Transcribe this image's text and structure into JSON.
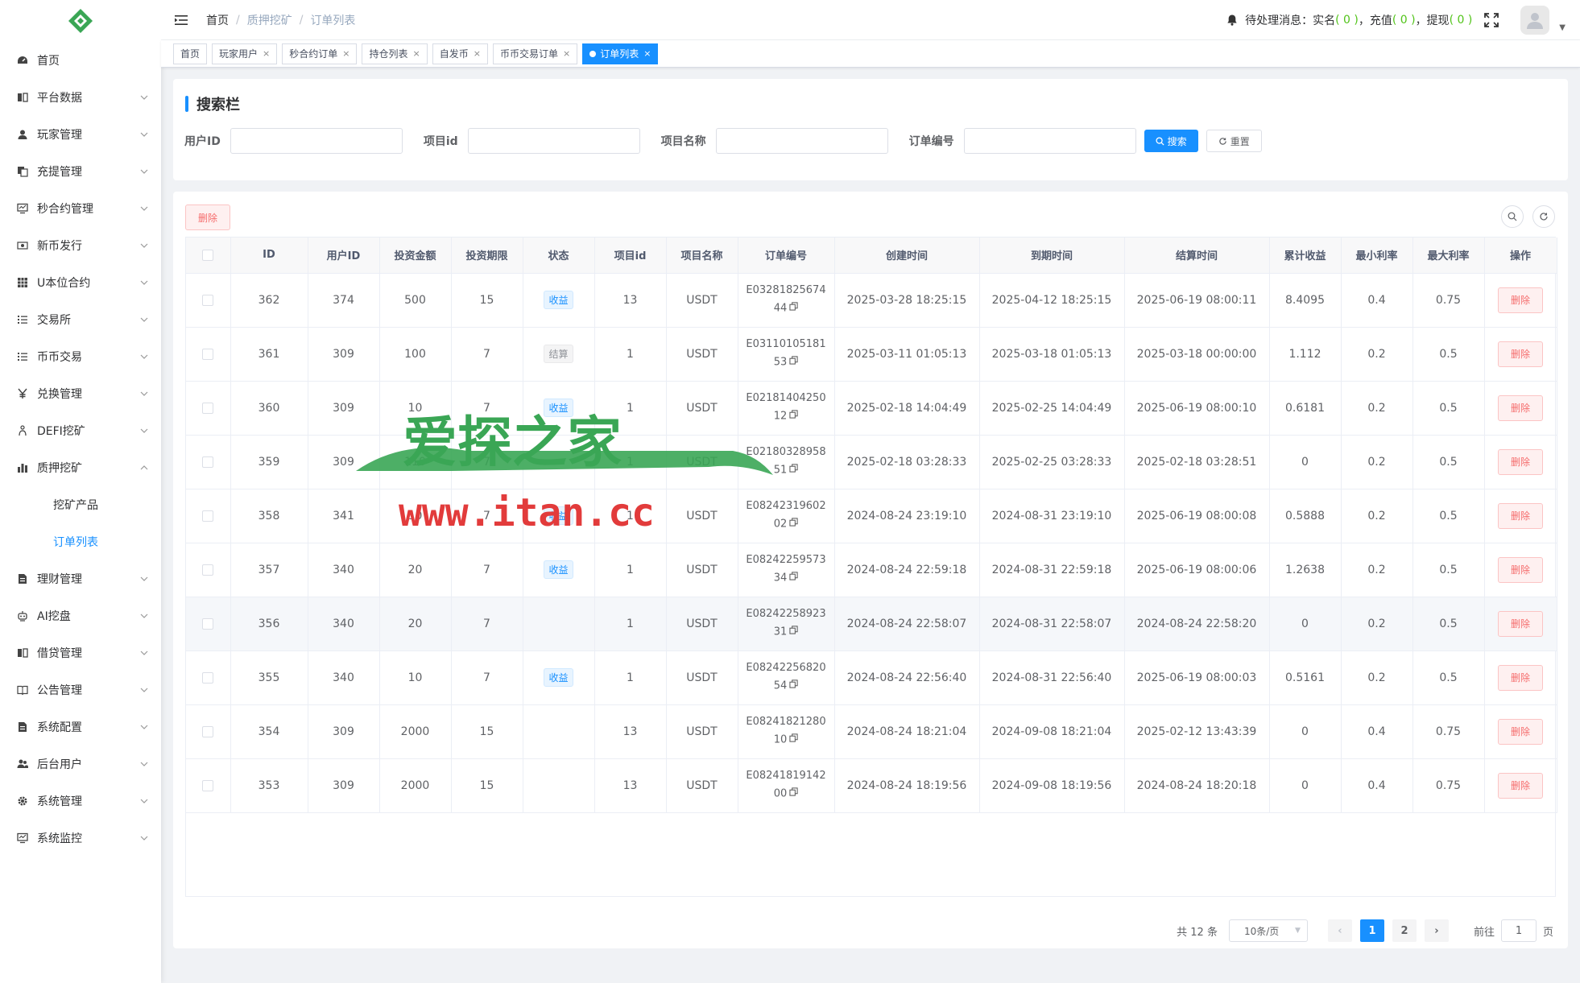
{
  "sidebar": {
    "items": [
      {
        "label": "首页",
        "icon": "dashboard-icon",
        "arrow": false
      },
      {
        "label": "平台数据",
        "icon": "book-icon",
        "arrow": true
      },
      {
        "label": "玩家管理",
        "icon": "user-icon",
        "arrow": true
      },
      {
        "label": "充提管理",
        "icon": "copy-icon",
        "arrow": true
      },
      {
        "label": "秒合约管理",
        "icon": "monitor-icon",
        "arrow": true
      },
      {
        "label": "新币发行",
        "icon": "money-icon",
        "arrow": true
      },
      {
        "label": "U本位合约",
        "icon": "grid-icon",
        "arrow": true
      },
      {
        "label": "交易所",
        "icon": "list-icon",
        "arrow": true
      },
      {
        "label": "币币交易",
        "icon": "list-icon",
        "arrow": true
      },
      {
        "label": "兑换管理",
        "icon": "yen-icon",
        "arrow": true
      },
      {
        "label": "DEFI挖矿",
        "icon": "druid-icon",
        "arrow": true
      },
      {
        "label": "质押挖矿",
        "icon": "chart-icon",
        "arrow": true,
        "expanded": true
      },
      {
        "label": "理财管理",
        "icon": "form-icon",
        "arrow": true
      },
      {
        "label": "AI挖盘",
        "icon": "robot-icon",
        "arrow": true
      },
      {
        "label": "借贷管理",
        "icon": "book-icon",
        "arrow": true
      },
      {
        "label": "公告管理",
        "icon": "read-icon",
        "arrow": true
      },
      {
        "label": "系统配置",
        "icon": "form-icon",
        "arrow": true
      },
      {
        "label": "后台用户",
        "icon": "peoples-icon",
        "arrow": true
      },
      {
        "label": "系统管理",
        "icon": "gear-icon",
        "arrow": true
      },
      {
        "label": "系统监控",
        "icon": "monitor-icon",
        "arrow": true
      }
    ],
    "submenu": [
      {
        "label": "挖矿产品",
        "active": false
      },
      {
        "label": "订单列表",
        "active": true
      }
    ]
  },
  "breadcrumb": [
    "首页",
    "质押挖矿",
    "订单列表"
  ],
  "topbar": {
    "pending_label": "待处理消息：",
    "real_name_label": "实名",
    "real_name_count": "( 0 )",
    "recharge_label": "，充值",
    "recharge_count": "( 0 )",
    "withdraw_label": "，提现",
    "withdraw_count": "( 0 )"
  },
  "tags": [
    {
      "label": "首页",
      "closable": false,
      "active": false
    },
    {
      "label": "玩家用户",
      "closable": true,
      "active": false
    },
    {
      "label": "秒合约订单",
      "closable": true,
      "active": false
    },
    {
      "label": "持仓列表",
      "closable": true,
      "active": false
    },
    {
      "label": "自发币",
      "closable": true,
      "active": false
    },
    {
      "label": "币币交易订单",
      "closable": true,
      "active": false
    },
    {
      "label": "订单列表",
      "closable": true,
      "active": true
    }
  ],
  "search": {
    "title": "搜索栏",
    "fields": [
      {
        "label": "用户ID",
        "value": ""
      },
      {
        "label": "项目id",
        "value": ""
      },
      {
        "label": "项目名称",
        "value": ""
      },
      {
        "label": "订单编号",
        "value": ""
      }
    ],
    "search_btn": "搜索",
    "reset_btn": "重置"
  },
  "toolbar": {
    "delete_label": "删除"
  },
  "table": {
    "columns": [
      "ID",
      "用户ID",
      "投资金额",
      "投资期限",
      "状态",
      "项目id",
      "项目名称",
      "订单编号",
      "创建时间",
      "到期时间",
      "结算时间",
      "累计收益",
      "最小利率",
      "最大利率",
      "操作"
    ],
    "delete_label": "删除",
    "rows": [
      {
        "id": "362",
        "uid": "374",
        "amount": "500",
        "term": "15",
        "status": "收益",
        "status_type": "blue",
        "pid": "13",
        "pname": "USDT",
        "order_l1": "E03281825674",
        "order_l2": "44",
        "created": "2025-03-28 18:25:15",
        "expire": "2025-04-12 18:25:15",
        "settle": "2025-06-19 08:00:11",
        "income": "8.4095",
        "min": "0.4",
        "max": "0.75"
      },
      {
        "id": "361",
        "uid": "309",
        "amount": "100",
        "term": "7",
        "status": "结算",
        "status_type": "gray",
        "pid": "1",
        "pname": "USDT",
        "order_l1": "E03110105181",
        "order_l2": "53",
        "created": "2025-03-11 01:05:13",
        "expire": "2025-03-18 01:05:13",
        "settle": "2025-03-18 00:00:00",
        "income": "1.112",
        "min": "0.2",
        "max": "0.5"
      },
      {
        "id": "360",
        "uid": "309",
        "amount": "10",
        "term": "7",
        "status": "收益",
        "status_type": "blue",
        "pid": "1",
        "pname": "USDT",
        "order_l1": "E02181404250",
        "order_l2": "12",
        "created": "2025-02-18 14:04:49",
        "expire": "2025-02-25 14:04:49",
        "settle": "2025-06-19 08:00:10",
        "income": "0.6181",
        "min": "0.2",
        "max": "0.5"
      },
      {
        "id": "359",
        "uid": "309",
        "amount": "110",
        "term": "7",
        "status": "",
        "status_type": "",
        "pid": "1",
        "pname": "USDT",
        "order_l1": "E02180328958",
        "order_l2": "51",
        "created": "2025-02-18 03:28:33",
        "expire": "2025-02-25 03:28:33",
        "settle": "2025-02-18 03:28:51",
        "income": "0",
        "min": "0.2",
        "max": "0.5"
      },
      {
        "id": "358",
        "uid": "341",
        "amount": "10",
        "term": "7",
        "status": "收益",
        "status_type": "blue",
        "pid": "1",
        "pname": "USDT",
        "order_l1": "E08242319602",
        "order_l2": "02",
        "created": "2024-08-24 23:19:10",
        "expire": "2024-08-31 23:19:10",
        "settle": "2025-06-19 08:00:08",
        "income": "0.5888",
        "min": "0.2",
        "max": "0.5"
      },
      {
        "id": "357",
        "uid": "340",
        "amount": "20",
        "term": "7",
        "status": "收益",
        "status_type": "blue",
        "pid": "1",
        "pname": "USDT",
        "order_l1": "E08242259573",
        "order_l2": "34",
        "created": "2024-08-24 22:59:18",
        "expire": "2024-08-31 22:59:18",
        "settle": "2025-06-19 08:00:06",
        "income": "1.2638",
        "min": "0.2",
        "max": "0.5"
      },
      {
        "id": "356",
        "uid": "340",
        "amount": "20",
        "term": "7",
        "status": "",
        "status_type": "",
        "pid": "1",
        "pname": "USDT",
        "order_l1": "E08242258923",
        "order_l2": "31",
        "created": "2024-08-24 22:58:07",
        "expire": "2024-08-31 22:58:07",
        "settle": "2024-08-24 22:58:20",
        "income": "0",
        "min": "0.2",
        "max": "0.5",
        "hover": true
      },
      {
        "id": "355",
        "uid": "340",
        "amount": "10",
        "term": "7",
        "status": "收益",
        "status_type": "blue",
        "pid": "1",
        "pname": "USDT",
        "order_l1": "E08242256820",
        "order_l2": "54",
        "created": "2024-08-24 22:56:40",
        "expire": "2024-08-31 22:56:40",
        "settle": "2025-06-19 08:00:03",
        "income": "0.5161",
        "min": "0.2",
        "max": "0.5"
      },
      {
        "id": "354",
        "uid": "309",
        "amount": "2000",
        "term": "15",
        "status": "",
        "status_type": "",
        "pid": "13",
        "pname": "USDT",
        "order_l1": "E08241821280",
        "order_l2": "10",
        "created": "2024-08-24 18:21:04",
        "expire": "2024-09-08 18:21:04",
        "settle": "2025-02-12 13:43:39",
        "income": "0",
        "min": "0.4",
        "max": "0.75"
      },
      {
        "id": "353",
        "uid": "309",
        "amount": "2000",
        "term": "15",
        "status": "",
        "status_type": "",
        "pid": "13",
        "pname": "USDT",
        "order_l1": "E08241819142",
        "order_l2": "00",
        "created": "2024-08-24 18:19:56",
        "expire": "2024-09-08 18:19:56",
        "settle": "2024-08-24 18:20:18",
        "income": "0",
        "min": "0.4",
        "max": "0.75"
      }
    ]
  },
  "pagination": {
    "total": "共 12 条",
    "page_size": "10条/页",
    "pages": [
      "1",
      "2"
    ],
    "current": "1",
    "goto_label": "前往",
    "goto_value": "1",
    "goto_suffix": "页"
  },
  "watermark": {
    "title": "爱探之家",
    "url": "www.itan.cc",
    "green": "#3aa655",
    "red": "#e23b3b"
  },
  "colors": {
    "primary": "#1890ff",
    "danger": "#f56c6c",
    "success": "#52c41a"
  }
}
